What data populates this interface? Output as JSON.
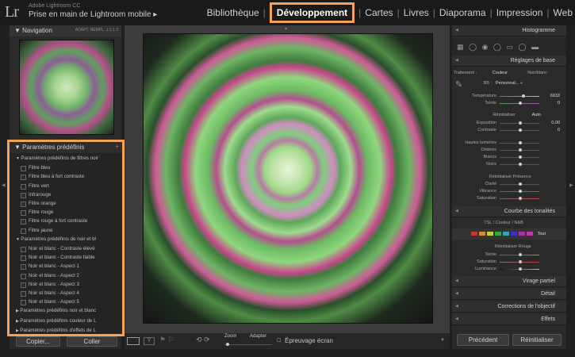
{
  "app": {
    "logo": "Lr",
    "brand_line1": "Adobe Lightroom CC",
    "brand_line2": "Prise en main de Lightroom mobile ▸",
    "modules": [
      "Bibliothèque",
      "Développement",
      "Cartes",
      "Livres",
      "Diaporama",
      "Impression",
      "Web"
    ],
    "active_module": "Développement"
  },
  "left": {
    "nav_title": "Navigation",
    "nav_extras": "ADAPT.  REMPL.  1:1  1:3",
    "presets_title": "Paramètres prédéfinis",
    "presets_add": "+",
    "tree": [
      {
        "type": "grp",
        "label": "Paramètres prédéfinis de filtres noir"
      },
      {
        "type": "itm",
        "label": "Filtre bleu"
      },
      {
        "type": "itm",
        "label": "Filtre bleu à fort contraste"
      },
      {
        "type": "itm",
        "label": "Filtre vert"
      },
      {
        "type": "itm",
        "label": "Infrarouge"
      },
      {
        "type": "itm",
        "label": "Filtre orange"
      },
      {
        "type": "itm",
        "label": "Filtre rouge"
      },
      {
        "type": "itm",
        "label": "Filtre rouge à fort contraste"
      },
      {
        "type": "itm",
        "label": "Filtre jaune"
      },
      {
        "type": "grp",
        "label": "Paramètres prédéfinis de noir et bl"
      },
      {
        "type": "itm",
        "label": "Noir et blanc - Contraste élevé"
      },
      {
        "type": "itm",
        "label": "Noir et blanc - Contraste faible"
      },
      {
        "type": "itm",
        "label": "Noir et blanc - Aspect 1"
      },
      {
        "type": "itm",
        "label": "Noir et blanc - Aspect 2"
      },
      {
        "type": "itm",
        "label": "Noir et blanc - Aspect 3"
      },
      {
        "type": "itm",
        "label": "Noir et blanc - Aspect 4"
      },
      {
        "type": "itm",
        "label": "Noir et blanc - Aspect 5"
      },
      {
        "type": "grpc",
        "label": "Paramètres prédéfinis noir et blanc"
      },
      {
        "type": "grpc",
        "label": "Paramètres prédéfinis couleur de L"
      },
      {
        "type": "grpc",
        "label": "Paramètres prédéfinis d'effets de L"
      }
    ],
    "copy_btn": "Copier...",
    "paste_btn": "Coller"
  },
  "toolbar": {
    "zoom_label": "Zoom",
    "zoom_value": "Adapter",
    "proof_label": "Épreuvage écran"
  },
  "right": {
    "histogram": "Histogramme",
    "basic": "Réglages de base",
    "treatment_label": "Traitement :",
    "treatment_color": "Couleur",
    "treatment_bw": "Noir/blanc",
    "wb_label": "BB :",
    "wb_value": "Personnal... ÷",
    "temp_label": "Température",
    "temp_value": "6933",
    "tint_label": "Teinte",
    "tint_value": "0",
    "tone_reset": "Réinitialiser",
    "tone_auto": "Auto",
    "exposure_label": "Exposition",
    "exposure_value": "0,00",
    "contrast_label": "Contraste",
    "contrast_value": "0",
    "highlights_label": "Hautes lumières",
    "shadows_label": "Ombres",
    "whites_label": "Blancs",
    "blacks_label": "Noirs",
    "presence": "Réinitialiser Présence",
    "clarity_label": "Clarté",
    "vibrance_label": "Vibrance",
    "saturation_label": "Saturation",
    "tone_curve": "Courbe des tonalités",
    "hsl_tabs": "TSL  /  Couleur  /  N&B",
    "hsl_all": "Tout",
    "red_reset": "Réinitialiser Rouge",
    "hue_label": "Teinte",
    "sat_label": "Saturation",
    "lum_label": "Luminance",
    "split": "Virage partiel",
    "detail": "Détail",
    "lens": "Corrections de l'objectif",
    "effects": "Effets",
    "prev_btn": "Précédent",
    "reset_btn": "Réinitialiser"
  }
}
